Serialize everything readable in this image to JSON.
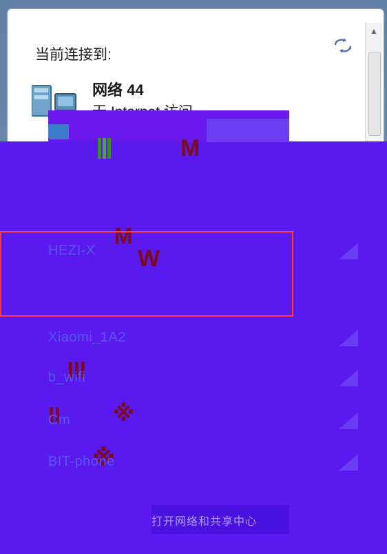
{
  "header": {
    "title": "当前连接到:",
    "refresh_icon": "refresh-icon"
  },
  "network": {
    "name": "网络  44",
    "status": "无 Internet 访问"
  },
  "overlay": {
    "artifact_label_1": "M",
    "artifact_label_2": "M",
    "artifact_label_3": "W",
    "artifact_label_4": "III",
    "artifact_label_5": "II",
    "artifact_label_6": "※",
    "artifact_label_7": "※"
  },
  "wifi_list": [
    {
      "label": "HEZI-X",
      "signal": "signal-icon"
    },
    {
      "label": "Xiaomi_1A2",
      "signal": "signal-icon"
    },
    {
      "label": "b_wifi",
      "signal": "signal-icon"
    },
    {
      "label": "Cm",
      "signal": "signal-icon"
    },
    {
      "label": "BIT-phone",
      "signal": "signal-icon"
    }
  ],
  "bottom": {
    "link_text": "打开网络和共享中心"
  },
  "colors": {
    "accent": "#5a19ef",
    "highlight": "#ff3a3a",
    "text": "#1a1a1a"
  }
}
